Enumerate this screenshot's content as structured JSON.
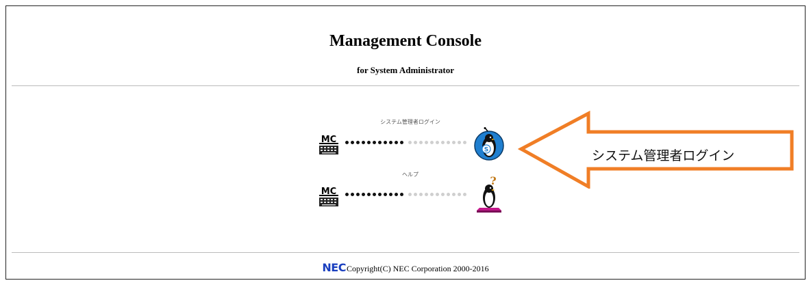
{
  "header": {
    "title": "Management Console",
    "subtitle": "for System Administrator"
  },
  "menu": [
    {
      "label": "システム管理者ログイン",
      "icon": "mc-keyboard-icon",
      "target_icon": "penguin-server-icon"
    },
    {
      "label": "ヘルプ",
      "icon": "mc-keyboard-icon",
      "target_icon": "penguin-help-icon"
    }
  ],
  "callout": {
    "text": "システム管理者ログイン",
    "color": "#f07e26"
  },
  "footer": {
    "logo": "NEC",
    "copyright": "Copyright(C) NEC Corporation 2000-2016"
  },
  "colors": {
    "nec_blue": "#1a3fbf",
    "server_blue": "#1f7fd0",
    "help_magenta": "#c2188a"
  }
}
